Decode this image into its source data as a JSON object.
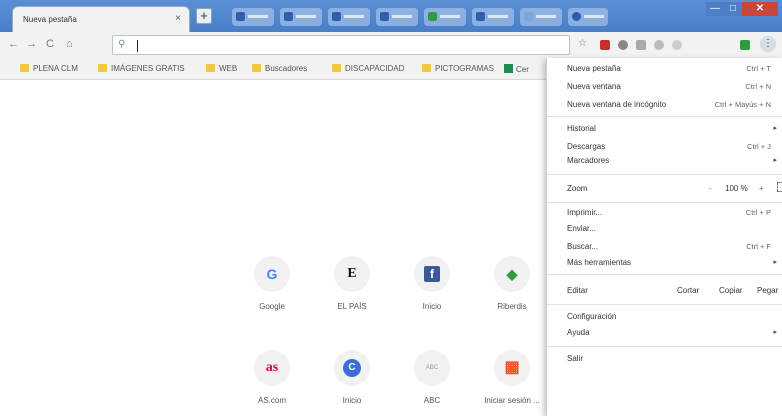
{
  "tab": {
    "title": "Nueva pestaña",
    "close": "×",
    "new_tab": "+"
  },
  "window": {
    "minimize": "—",
    "maximize": "□",
    "close": "✕"
  },
  "toolbar": {
    "back": "←",
    "forward": "→",
    "reload": "C",
    "home": "⌂",
    "search_glyph": "⚲",
    "star": "☆",
    "menu_glyph": "⋮"
  },
  "bookmarks": [
    {
      "label": "PLENA CLM",
      "icon": "folder-icon"
    },
    {
      "label": "IMÁGENES GRATIS",
      "icon": "folder-icon"
    },
    {
      "label": "WEB",
      "icon": "folder-icon"
    },
    {
      "label": "Buscadores",
      "icon": "folder-icon"
    },
    {
      "label": "DISCAPACIDAD",
      "icon": "folder-icon"
    },
    {
      "label": "PICTOGRAMAS",
      "icon": "folder-icon"
    },
    {
      "label": "Cer",
      "icon": "sheets-icon"
    }
  ],
  "shortcuts": [
    {
      "label": "Google",
      "glyph": "G",
      "color": "#4285f4"
    },
    {
      "label": "EL PAÍS",
      "glyph": "E",
      "color": "#111111"
    },
    {
      "label": "Inicio",
      "glyph": "f",
      "color": "#3b5998"
    },
    {
      "label": "Riberdis",
      "glyph": "◆",
      "color": "#2e9b3e"
    },
    {
      "label": "AS.com",
      "glyph": "as",
      "color": "#c8102e"
    },
    {
      "label": "Inicio",
      "glyph": "C",
      "color": "#3b6fd6"
    },
    {
      "label": "ABC",
      "glyph": "ABC",
      "color": "#999999"
    },
    {
      "label": "Iniciar sesión ...",
      "glyph": "▦",
      "color": "#f25022"
    }
  ],
  "menu": {
    "new_tab": "Nueva pestaña",
    "new_tab_sc": "Ctrl + T",
    "new_window": "Nueva ventana",
    "new_window_sc": "Ctrl + N",
    "incognito": "Nueva ventana de incógnito",
    "incognito_sc": "Ctrl + Mayús + N",
    "history": "Historial",
    "downloads": "Descargas",
    "downloads_sc": "Ctrl + J",
    "bookmarks": "Marcadores",
    "zoom": "Zoom",
    "zoom_minus": "-",
    "zoom_value": "100 %",
    "zoom_plus": "+",
    "print": "Imprimir...",
    "print_sc": "Ctrl + P",
    "send": "Enviar...",
    "find": "Buscar...",
    "find_sc": "Ctrl + F",
    "more_tools": "Más herramientas",
    "edit": "Editar",
    "cut": "Cortar",
    "copy": "Copiar",
    "paste": "Pegar",
    "settings": "Configuración",
    "help": "Ayuda",
    "exit": "Salir",
    "arrow": "▸"
  }
}
